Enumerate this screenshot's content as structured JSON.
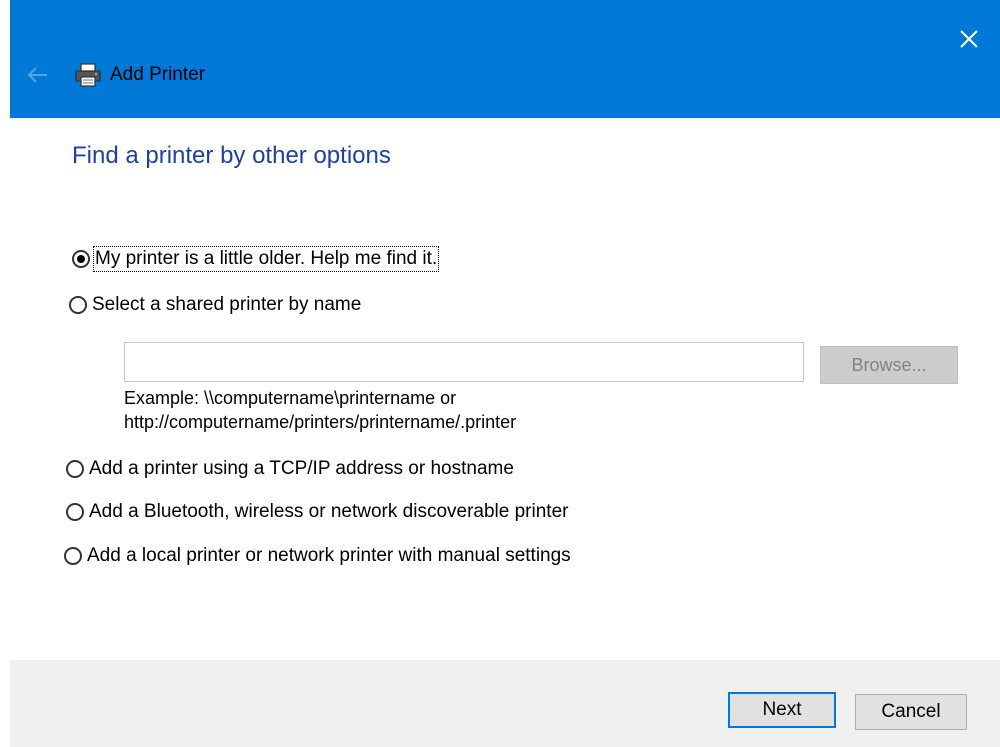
{
  "window": {
    "title": "Add Printer",
    "titlebar_color": "#0078d7"
  },
  "page": {
    "title": "Find a printer by other options",
    "title_color": "#1e3fa8"
  },
  "options": [
    {
      "label": "My printer is a little older. Help me find it.",
      "checked": true
    },
    {
      "label": "Select a shared printer by name",
      "checked": false
    },
    {
      "label": "Add a printer using a TCP/IP address or hostname",
      "checked": false
    },
    {
      "label": "Add a Bluetooth, wireless or network discoverable printer",
      "checked": false
    },
    {
      "label": "Add a local printer or network printer with manual settings",
      "checked": false
    }
  ],
  "shared": {
    "input_value": "",
    "browse_label": "Browse...",
    "example_line1": "Example: \\\\computername\\printername or",
    "example_line2": "http://computername/printers/printername/.printer"
  },
  "footer": {
    "next_label": "Next",
    "cancel_label": "Cancel"
  },
  "icons": {
    "close": "close-icon",
    "back": "back-arrow-icon",
    "printer": "printer-icon"
  }
}
